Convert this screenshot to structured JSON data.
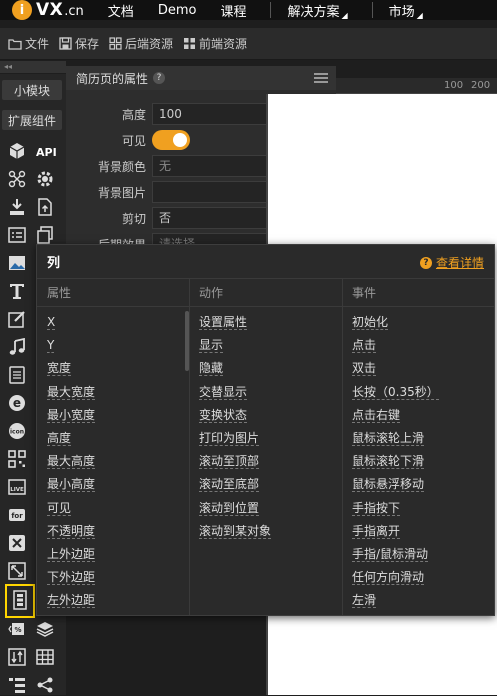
{
  "nav": {
    "logo_text": "VX",
    "logo_suffix": ".cn",
    "items": [
      "文档",
      "Demo",
      "课程",
      "解决方案",
      "市场"
    ]
  },
  "toolbar": {
    "file": "文件",
    "save": "保存",
    "backend": "后端资源",
    "frontend": "前端资源"
  },
  "rail": {
    "collapse": "◂◂",
    "tab_small": "小模块",
    "tab_ext": "扩展组件",
    "api": "API"
  },
  "props": {
    "title": "简历页的属性",
    "height_label": "高度",
    "height_value": "100",
    "height_unit": "%",
    "visible_label": "可见",
    "bgcolor_label": "背景颜色",
    "bgcolor_value": "无",
    "bgimage_label": "背景图片",
    "clip_label": "剪切",
    "clip_value": "否",
    "effect_label": "后期效果",
    "effect_value": "请选择"
  },
  "ruler": {
    "mark1": "100",
    "mark2": "200"
  },
  "popover": {
    "title": "列",
    "help_link": "查看详情",
    "columns": [
      {
        "header": "属性",
        "items": [
          "X",
          "Y",
          "宽度",
          "最大宽度",
          "最小宽度",
          "高度",
          "最大高度",
          "最小高度",
          "可见",
          "不透明度",
          "上外边距",
          "下外边距",
          "左外边距"
        ]
      },
      {
        "header": "动作",
        "items": [
          "设置属性",
          "显示",
          "隐藏",
          "交替显示",
          "变换状态",
          "打印为图片",
          "滚动至顶部",
          "滚动至底部",
          "滚动到位置",
          "滚动到某对象"
        ]
      },
      {
        "header": "事件",
        "items": [
          "初始化",
          "点击",
          "双击",
          "长按（0.35秒）",
          "点击右键",
          "鼠标滚轮上滑",
          "鼠标滚轮下滑",
          "鼠标悬浮移动",
          "手指按下",
          "手指离开",
          "手指/鼠标滑动",
          "任何方向滑动",
          "左滑"
        ]
      }
    ]
  },
  "colors": {
    "accent": "#f0a020",
    "highlight": "#ffd500"
  }
}
